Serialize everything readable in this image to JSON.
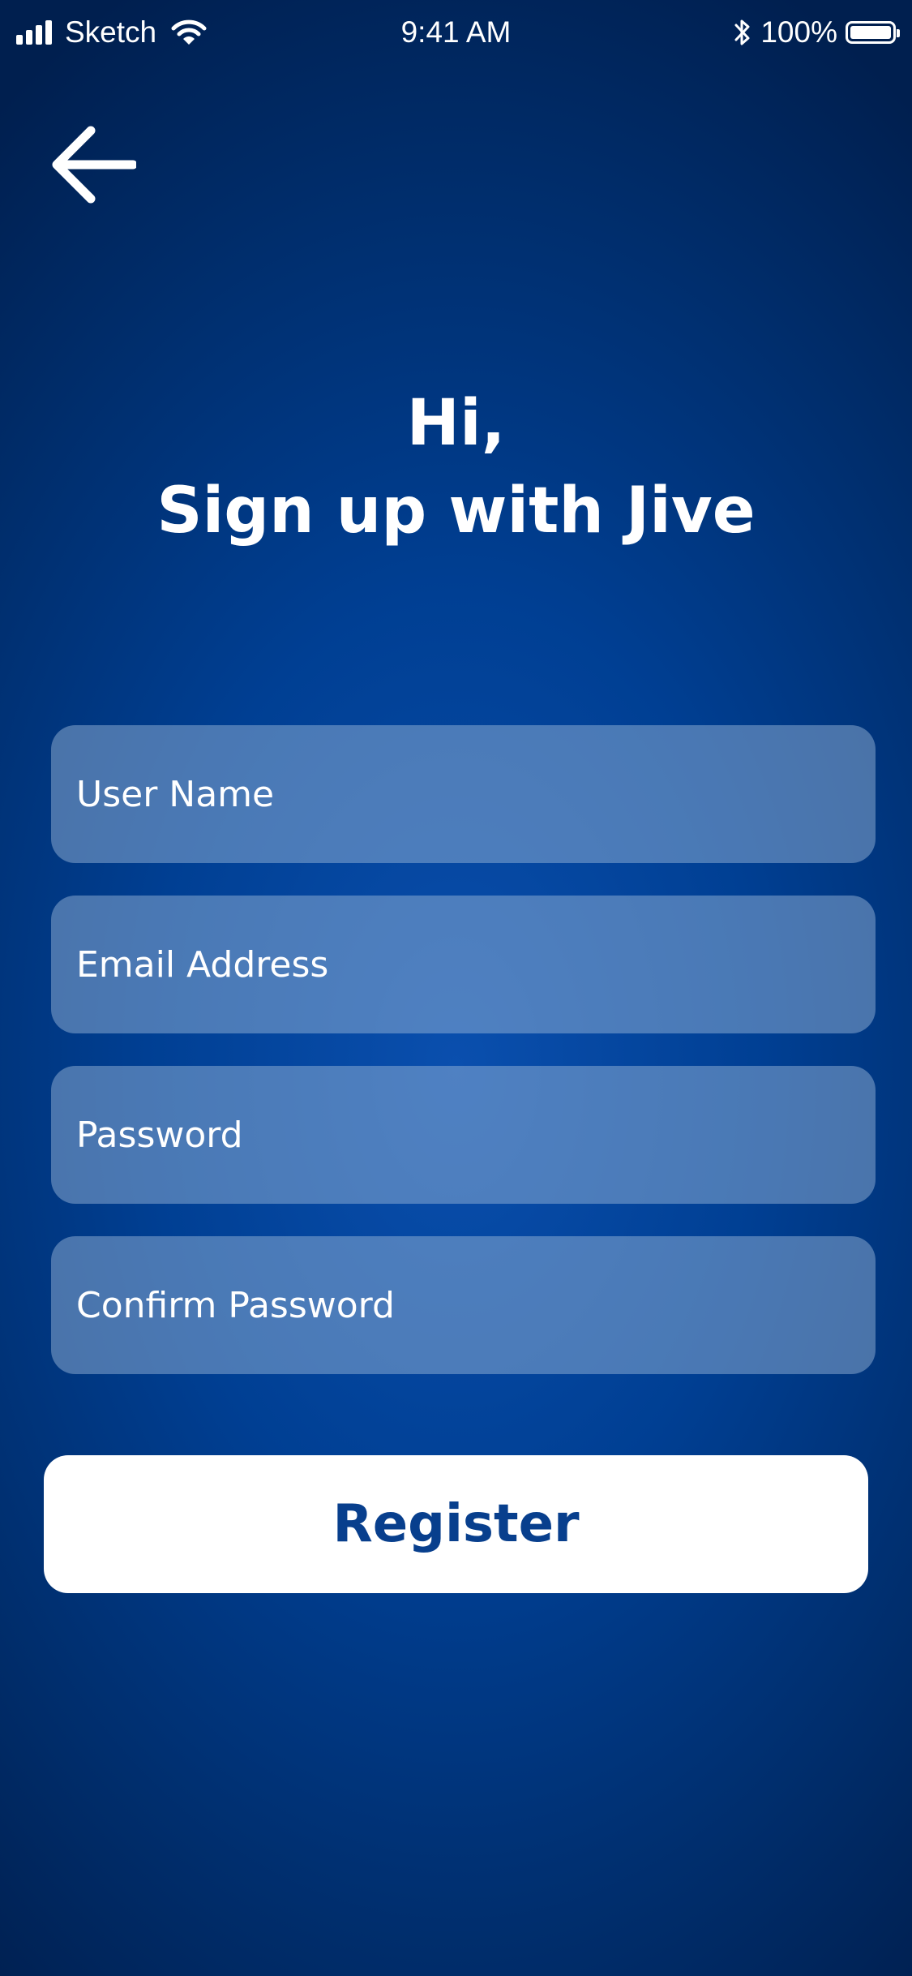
{
  "status_bar": {
    "carrier": "Sketch",
    "time": "9:41 AM",
    "battery_percent": "100%",
    "signal_icon": "cellular-signal-icon",
    "wifi_icon": "wifi-icon",
    "bluetooth_icon": "bluetooth-icon",
    "battery_icon": "battery-icon",
    "battery_level": 1.0
  },
  "nav": {
    "back_icon": "arrow-left-icon"
  },
  "heading": {
    "line1": "Hi,",
    "line2": "Sign up with Jive"
  },
  "form": {
    "username_placeholder": "User Name",
    "email_placeholder": "Email Address",
    "password_placeholder": "Password",
    "confirm_password_placeholder": "Confirm Password"
  },
  "register": {
    "label": "Register"
  },
  "colors": {
    "background_center": "#0a4fae",
    "background_edge": "#001f4f",
    "field_fill": "#9ab8da",
    "button_background": "#ffffff",
    "button_text": "#083f8d",
    "text": "#ffffff"
  }
}
